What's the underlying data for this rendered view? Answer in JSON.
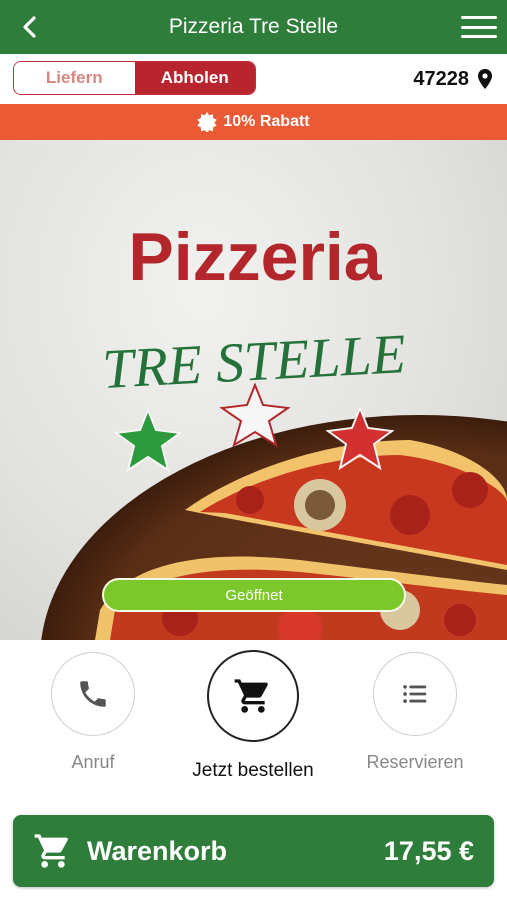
{
  "header": {
    "title": "Pizzeria Tre Stelle",
    "back_icon": "chevron-left-icon",
    "menu_icon": "hamburger-menu-icon",
    "background": "#2e7d3a"
  },
  "mode": {
    "options": [
      {
        "label": "Liefern",
        "active": false
      },
      {
        "label": "Abholen",
        "active": true
      }
    ],
    "zip": "47228",
    "zip_icon": "location-pin-icon",
    "accent": "#b8252f"
  },
  "discount": {
    "label": "10% Rabatt",
    "icon": "badge-star-icon",
    "background": "#ea5a35"
  },
  "hero": {
    "logo_line1": "Pizzeria",
    "logo_line2": "TRE STELLE",
    "status": "Geöffnet",
    "status_color": "#7cc72a"
  },
  "actions": [
    {
      "label": "Anruf",
      "icon": "phone-icon"
    },
    {
      "label": "Jetzt bestellen",
      "icon": "cart-icon"
    },
    {
      "label": "Reservieren",
      "icon": "list-icon"
    }
  ],
  "cart": {
    "label": "Warenkorb",
    "total": "17,55 €",
    "icon": "cart-icon",
    "background": "#2e7d3a"
  }
}
